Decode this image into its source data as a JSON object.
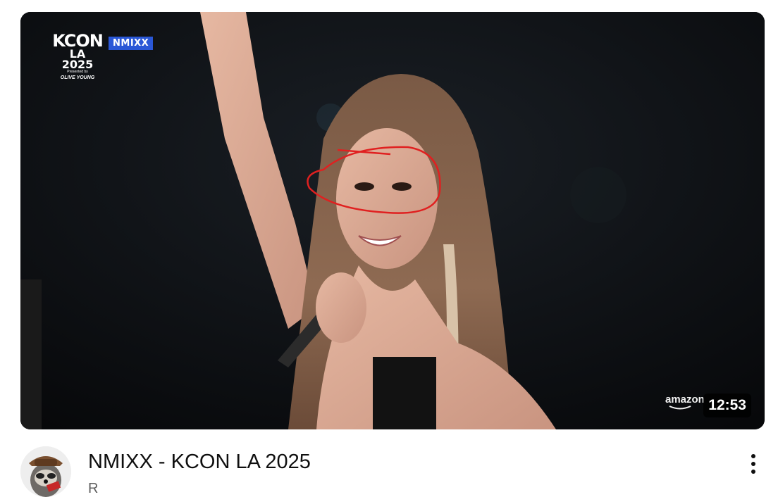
{
  "video": {
    "title": "NMIXX - KCON LA 2025",
    "channel_partial": "R",
    "duration": "12:53",
    "overlay": {
      "event_line1": "KCON",
      "event_line2": "LA",
      "event_line3": "2025",
      "presented_by": "Presented by",
      "sponsor": "OLIVE YOUNG",
      "artist_tag": "NMIXX",
      "provider_watermark": "amazon"
    },
    "annotation_color": "#e02020"
  },
  "icons": {
    "more": "vertical-ellipsis-icon",
    "avatar": "raccoon-avatar"
  }
}
